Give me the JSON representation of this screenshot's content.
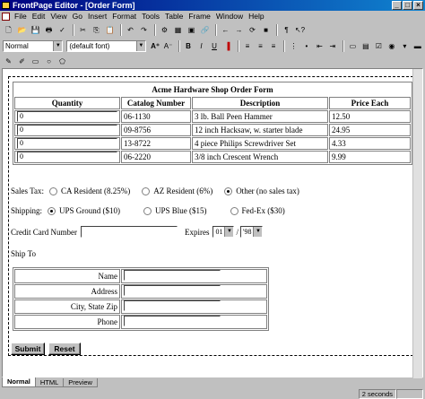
{
  "window": {
    "title": "FrontPage Editor - [Order Form]",
    "controls": [
      "_",
      "□",
      "×"
    ]
  },
  "menu": [
    "File",
    "Edit",
    "View",
    "Go",
    "Insert",
    "Format",
    "Tools",
    "Table",
    "Frame",
    "Window",
    "Help"
  ],
  "toolbar": {
    "style_value": "Normal",
    "font_value": "(default font)"
  },
  "form": {
    "caption": "Acme Hardware Shop Order Form",
    "headers": [
      "Quantity",
      "Catalog Number",
      "Description",
      "Price Each"
    ],
    "rows": [
      {
        "qty": "0",
        "catalog": "06-1130",
        "desc": "3 lb. Ball Peen Hammer",
        "price": "12.50"
      },
      {
        "qty": "0",
        "catalog": "09-8756",
        "desc": "12 inch Hacksaw, w. starter blade",
        "price": "24.95"
      },
      {
        "qty": "0",
        "catalog": "13-8722",
        "desc": "4 piece Philips Screwdriver Set",
        "price": "4.33"
      },
      {
        "qty": "0",
        "catalog": "06-2220",
        "desc": "3/8 inch Crescent Wrench",
        "price": "9.99"
      }
    ],
    "sales_tax": {
      "label": "Sales Tax:",
      "options": [
        "CA Resident (8.25%)",
        "AZ Resident (6%)",
        "Other (no sales tax)"
      ],
      "selected": 2
    },
    "shipping": {
      "label": "Shipping:",
      "options": [
        "UPS Ground ($10)",
        "UPS Blue ($15)",
        "Fed-Ex ($30)"
      ],
      "selected": 0
    },
    "credit_card_label": "Credit Card Number",
    "expires_label": "Expires",
    "expires_month": "01",
    "expires_sep": "/",
    "expires_year": "'98",
    "ship_to_label": "Ship To",
    "ship_fields": [
      "Name",
      "Address",
      "City, State Zip",
      "Phone"
    ],
    "submit_label": "Submit",
    "reset_label": "Reset"
  },
  "tabs": [
    "Normal",
    "HTML",
    "Preview"
  ],
  "status": {
    "load_time": "2 seconds"
  }
}
